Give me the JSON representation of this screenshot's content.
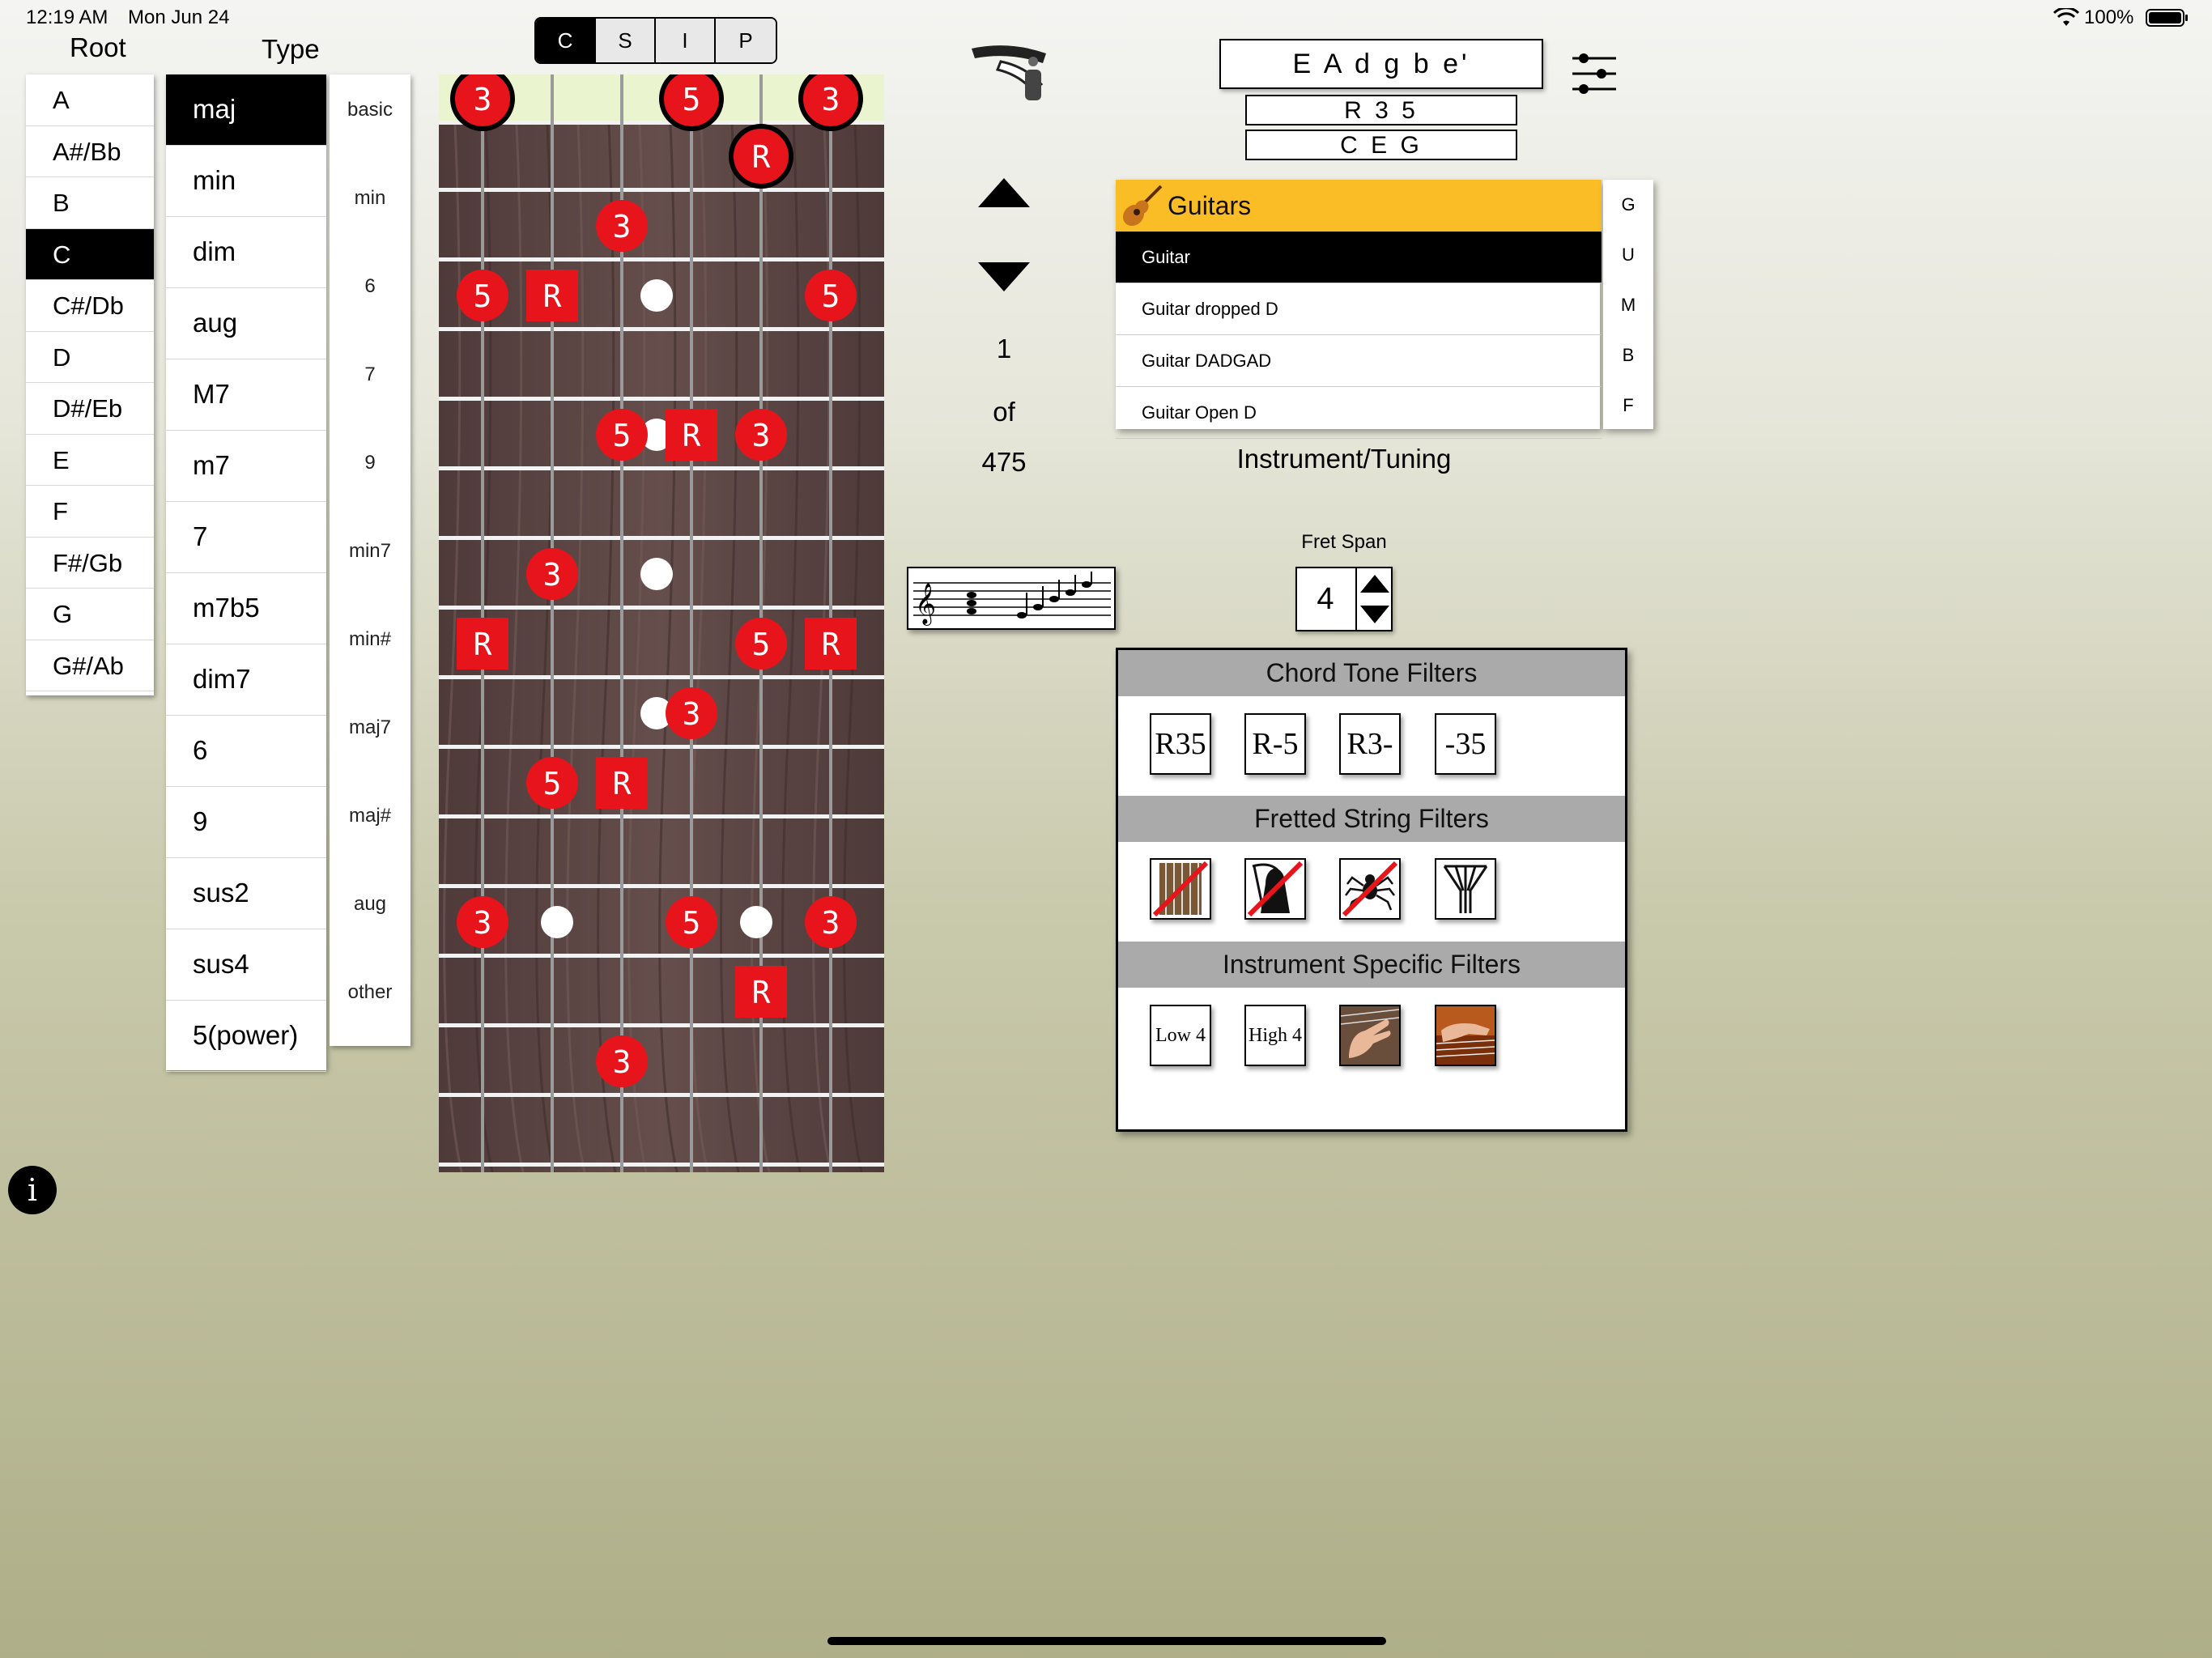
{
  "status_bar": {
    "time": "12:19 AM",
    "date": "Mon Jun 24",
    "battery": "100%"
  },
  "root": {
    "header": "Root",
    "items": [
      "A",
      "A#/Bb",
      "B",
      "C",
      "C#/Db",
      "D",
      "D#/Eb",
      "E",
      "F",
      "F#/Gb",
      "G",
      "G#/Ab"
    ],
    "selected_index": 3
  },
  "type": {
    "header": "Type",
    "items": [
      "maj",
      "min",
      "dim",
      "aug",
      "M7",
      "m7",
      "7",
      "m7b5",
      "dim7",
      "6",
      "9",
      "sus2",
      "sus4",
      "5(power)"
    ],
    "selected_index": 0,
    "categories": [
      "basic",
      "min",
      "6",
      "7",
      "9",
      "min7",
      "min#",
      "maj7",
      "maj#",
      "aug",
      "other"
    ]
  },
  "mode_tabs": {
    "items": [
      "C",
      "S",
      "I",
      "P"
    ],
    "selected_index": 0
  },
  "fretboard": {
    "strings": 6,
    "colors": {
      "wood": "#5b4644",
      "marker": "#e8141b",
      "nut": "#eaf5d0"
    },
    "markers": [
      {
        "string": 1,
        "fret": 0,
        "label": "3",
        "shape": "circle",
        "open": true
      },
      {
        "string": 4,
        "fret": 0,
        "label": "5",
        "shape": "circle",
        "open": true
      },
      {
        "string": 6,
        "fret": 0,
        "label": "3",
        "shape": "circle",
        "open": true
      },
      {
        "string": 5,
        "fret": 1,
        "label": "R",
        "shape": "circle",
        "open": true
      },
      {
        "string": 3,
        "fret": 2,
        "label": "3",
        "shape": "circle"
      },
      {
        "string": 1,
        "fret": 3,
        "label": "5",
        "shape": "circle"
      },
      {
        "string": 2,
        "fret": 3,
        "label": "R",
        "shape": "square"
      },
      {
        "string": 6,
        "fret": 3,
        "label": "5",
        "shape": "circle"
      },
      {
        "string": 3,
        "fret": 5,
        "label": "5",
        "shape": "circle"
      },
      {
        "string": 4,
        "fret": 5,
        "label": "R",
        "shape": "square"
      },
      {
        "string": 5,
        "fret": 5,
        "label": "3",
        "shape": "circle"
      },
      {
        "string": 2,
        "fret": 7,
        "label": "3",
        "shape": "circle"
      },
      {
        "string": 1,
        "fret": 8,
        "label": "R",
        "shape": "square"
      },
      {
        "string": 5,
        "fret": 8,
        "label": "5",
        "shape": "circle"
      },
      {
        "string": 6,
        "fret": 8,
        "label": "R",
        "shape": "square"
      },
      {
        "string": 4,
        "fret": 9,
        "label": "3",
        "shape": "circle"
      },
      {
        "string": 2,
        "fret": 10,
        "label": "5",
        "shape": "circle"
      },
      {
        "string": 3,
        "fret": 10,
        "label": "R",
        "shape": "square"
      },
      {
        "string": 1,
        "fret": 12,
        "label": "3",
        "shape": "circle"
      },
      {
        "string": 4,
        "fret": 12,
        "label": "5",
        "shape": "circle"
      },
      {
        "string": 6,
        "fret": 12,
        "label": "3",
        "shape": "circle"
      },
      {
        "string": 5,
        "fret": 13,
        "label": "R",
        "shape": "square"
      },
      {
        "string": 3,
        "fret": 14,
        "label": "3",
        "shape": "circle"
      }
    ]
  },
  "navigation": {
    "current": "1",
    "of_label": "of",
    "total": "475"
  },
  "tuning": {
    "notes": "E A d g b e'",
    "formula": "R 3 5",
    "chord_notes": "C E G"
  },
  "instrument": {
    "group": "Guitars",
    "items": [
      "Guitar",
      "Guitar dropped D",
      "Guitar DADGAD",
      "Guitar Open D"
    ],
    "selected_index": 0,
    "index_letters": [
      "G",
      "U",
      "M",
      "B",
      "F"
    ],
    "caption": "Instrument/Tuning",
    "header_color": "#fbbd25"
  },
  "fret_span": {
    "label": "Fret Span",
    "value": "4"
  },
  "filters": {
    "chord_tone": {
      "title": "Chord Tone Filters",
      "buttons": [
        "R35",
        "R-5",
        "R3-",
        "-35"
      ]
    },
    "fretted_string": {
      "title": "Fretted String Filters"
    },
    "instrument_specific": {
      "title": "Instrument Specific Filters",
      "buttons": [
        "Low 4",
        "High 4"
      ]
    }
  }
}
